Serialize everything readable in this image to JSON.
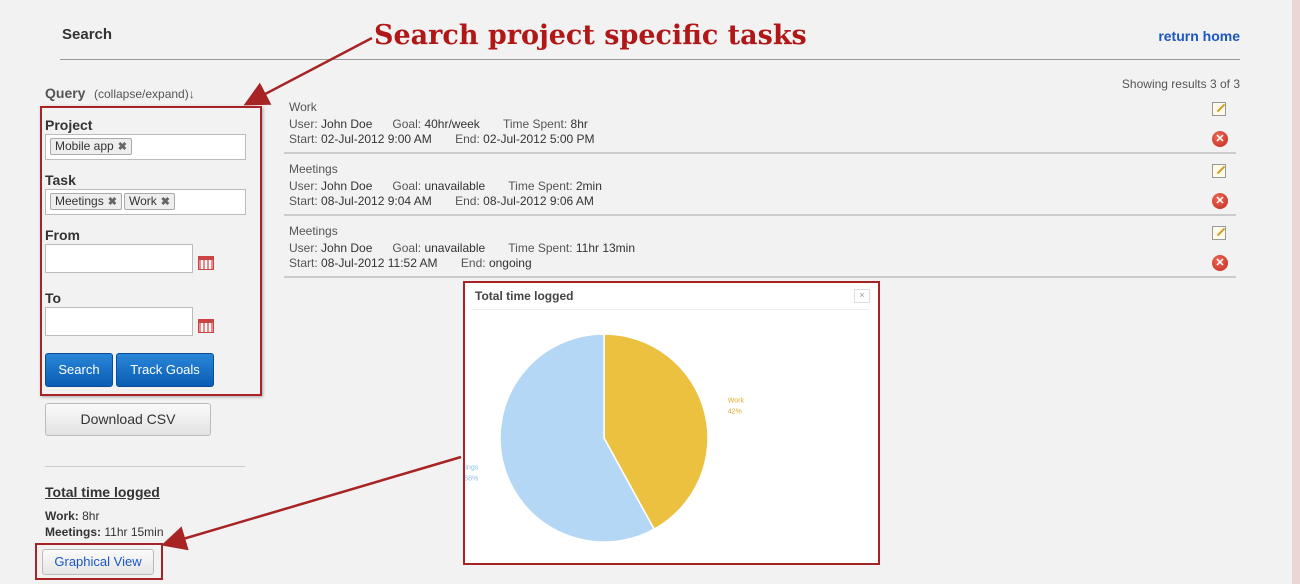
{
  "header": {
    "title": "Search",
    "return_home": "return home"
  },
  "annotation": {
    "title": "Search project specific tasks"
  },
  "query": {
    "title": "Query",
    "toggle": "(collapse/expand)↓",
    "project_label": "Project",
    "project_tokens": [
      "Mobile app"
    ],
    "task_label": "Task",
    "task_tokens": [
      "Meetings",
      "Work"
    ],
    "from_label": "From",
    "to_label": "To",
    "search_button": "Search",
    "track_goals_button": "Track Goals",
    "download_csv_button": "Download CSV"
  },
  "summary": {
    "title": "Total time logged",
    "work_label": "Work:",
    "work_value": "8hr",
    "meetings_label": "Meetings:",
    "meetings_value": "11hr 15min",
    "graphical_view_button": "Graphical View"
  },
  "results": {
    "count_text": "Showing results 3 of 3",
    "rows": [
      {
        "task": "Work",
        "user_label": "User:",
        "user": "John Doe",
        "goal_label": "Goal:",
        "goal": "40hr/week",
        "time_label": "Time Spent:",
        "time": "8hr",
        "start_label": "Start:",
        "start": "02-Jul-2012 9:00 AM",
        "end_label": "End:",
        "end": "02-Jul-2012 5:00 PM"
      },
      {
        "task": "Meetings",
        "user_label": "User:",
        "user": "John Doe",
        "goal_label": "Goal:",
        "goal": "unavailable",
        "time_label": "Time Spent:",
        "time": "2min",
        "start_label": "Start:",
        "start": "08-Jul-2012 9:04 AM",
        "end_label": "End:",
        "end": "08-Jul-2012 9:06 AM"
      },
      {
        "task": "Meetings",
        "user_label": "User:",
        "user": "John Doe",
        "goal_label": "Goal:",
        "goal": "unavailable",
        "time_label": "Time Spent:",
        "time": "11hr 13min",
        "start_label": "Start:",
        "start": "08-Jul-2012 11:52 AM",
        "end_label": "End:",
        "end": "ongoing"
      }
    ]
  },
  "chart_popup": {
    "title": "Total time logged",
    "close": "×"
  },
  "colors": {
    "accent_blue": "#1a56c4",
    "annotation_red": "#b01818",
    "work": "#ecc13f",
    "meetings": "#b3d7f5"
  },
  "chart_data": {
    "type": "pie",
    "title": "Total time logged",
    "slices": [
      {
        "label": "Work",
        "value": 42,
        "display": "42%",
        "color": "#ecc13f"
      },
      {
        "label": "Meetings",
        "value": 58,
        "display": "58%",
        "color": "#b3d7f5"
      }
    ]
  }
}
